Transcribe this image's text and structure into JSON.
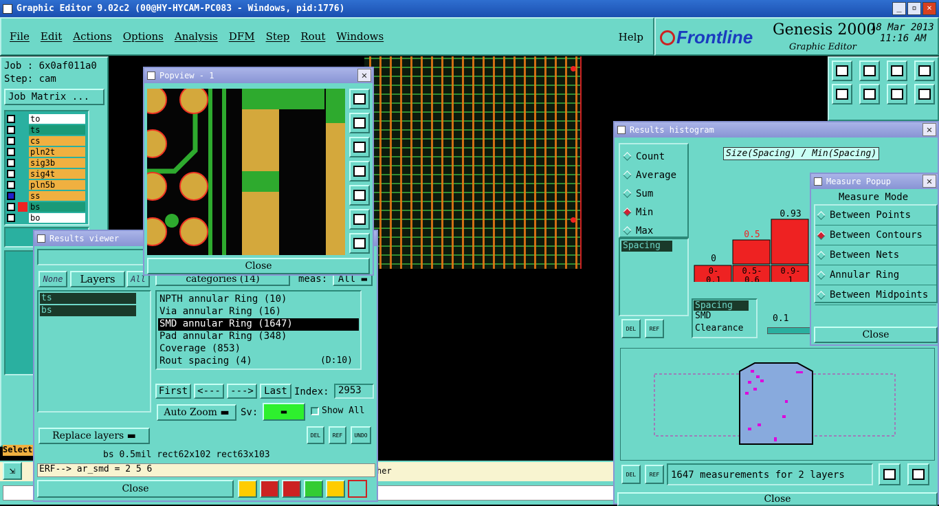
{
  "window": {
    "title": "Graphic Editor 9.02c2 (00@HY-HYCAM-PC083 - Windows, pid:1776)"
  },
  "menu": [
    "File",
    "Edit",
    "Actions",
    "Options",
    "Analysis",
    "DFM",
    "Step",
    "Rout",
    "Windows"
  ],
  "help": "Help",
  "brand": {
    "logo": "Frontline",
    "product": "Genesis 2000",
    "subtitle": "Graphic Editor",
    "date": "18 Mar 2013",
    "time": "11:16 AM"
  },
  "job": {
    "job_label": "Job : 6x0af011a0",
    "step_label": "Step: cam",
    "matrix_btn": "Job Matrix ..."
  },
  "layers": [
    {
      "name": "to",
      "color": "#ffffff"
    },
    {
      "name": "ts",
      "color": "#1a9a78"
    },
    {
      "name": "cs",
      "color": "#f0b040"
    },
    {
      "name": "pln2t",
      "color": "#f0b040"
    },
    {
      "name": "sig3b",
      "color": "#f0b040"
    },
    {
      "name": "sig4t",
      "color": "#f0b040"
    },
    {
      "name": "pln5b",
      "color": "#f0b040"
    },
    {
      "name": "ss",
      "color": "#f0b040"
    },
    {
      "name": "bs",
      "color": "#1a9a78"
    },
    {
      "name": "bo",
      "color": "#ffffff"
    }
  ],
  "popview": {
    "title": "Popview - 1",
    "close": "Close"
  },
  "results_viewer": {
    "title": "Results viewer",
    "none": "None",
    "layers": "Layers",
    "all": "All",
    "layer_list": [
      "ts",
      "bs"
    ],
    "categories": "categories (14)",
    "meas": "meas:",
    "meas_val": "All",
    "items": [
      "NPTH annular Ring (10)",
      "Via annular Ring (16)",
      "SMD annular Ring (1647)",
      "Pad annular Ring (348)",
      "Coverage (853)",
      "Rout spacing (4)"
    ],
    "rout_suffix": "(D:10)",
    "first": "First",
    "prev": "<---",
    "next": "--->",
    "last": "Last",
    "index_label": "Index:",
    "index_val": "2953",
    "auto_zoom": "Auto Zoom",
    "sv": "Sv:",
    "show_all": "Show All",
    "replace_layers": "Replace layers",
    "del": "DEL",
    "ref": "REF",
    "undo": "UNDO",
    "status": "bs 0.5mil  rect62x102  rect63x103",
    "close": "Close"
  },
  "command": {
    "prompt": "ERF--> ar_smd = 2 5 6",
    "select": "Select",
    "tail": "her"
  },
  "histogram": {
    "title": "Results histogram",
    "options": [
      "Count",
      "Average",
      "Sum",
      "Min",
      "Max"
    ],
    "selected": "Min",
    "chart_title": "Size(Spacing) / Min(Spacing)",
    "list": [
      "Spacing"
    ],
    "list2": [
      "Spacing",
      "SMD",
      "Clearance"
    ],
    "slider_val": "0.1",
    "status": "1647 measurements for 2 layers",
    "close": "Close",
    "bar_color": "#ee2222"
  },
  "chart_data": {
    "type": "bar",
    "categories": [
      "0-0.1",
      "0.5-0.6",
      "0.9-1"
    ],
    "values": [
      0,
      0.5,
      0.93
    ],
    "value_labels": [
      "0",
      "0.5",
      "0.93"
    ],
    "title": "Size(Spacing) / Min(Spacing)"
  },
  "measure": {
    "title": "Measure Popup",
    "mode": "Measure Mode",
    "options": [
      "Between Points",
      "Between Contours",
      "Between Nets",
      "Annular Ring",
      "Between Midpoints"
    ],
    "selected": "Between Contours",
    "close": "Close"
  }
}
